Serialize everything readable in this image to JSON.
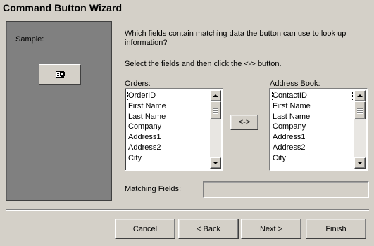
{
  "window": {
    "title": "Command Button Wizard"
  },
  "sample": {
    "label": "Sample:",
    "button_icon": "form-icon"
  },
  "prompt": {
    "question": "Which fields contain matching data the button can use to look up information?",
    "instruction": "Select the fields and then click the <-> button."
  },
  "orders": {
    "label": "Orders:",
    "items": [
      "OrderID",
      "First Name",
      "Last Name",
      "Company",
      "Address1",
      "Address2",
      "City"
    ],
    "selected_index": 0
  },
  "address_book": {
    "label": "Address Book:",
    "items": [
      "ContactID",
      "First Name",
      "Last Name",
      "Company",
      "Address1",
      "Address2",
      "City"
    ],
    "selected_index": 0
  },
  "match_button": {
    "label": "<->"
  },
  "matching": {
    "label": "Matching Fields:",
    "value": ""
  },
  "footer": {
    "cancel_label": "Cancel",
    "back_label": "< Back",
    "next_label": "Next >",
    "finish_label": "Finish"
  }
}
